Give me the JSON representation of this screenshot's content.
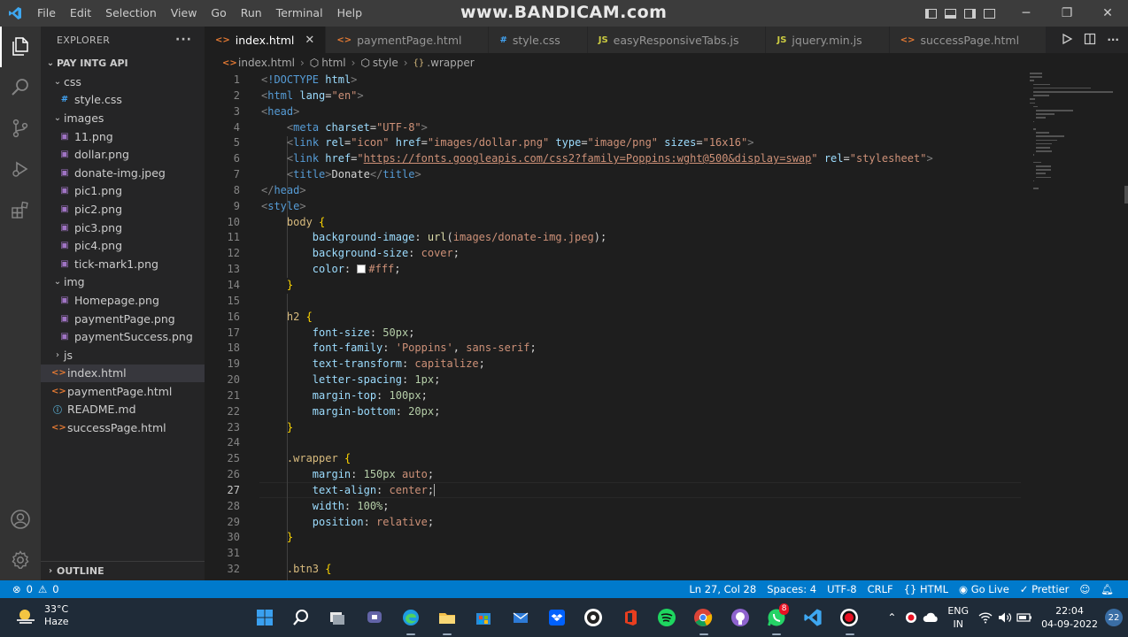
{
  "window": {
    "menu": [
      "File",
      "Edit",
      "Selection",
      "View",
      "Go",
      "Run",
      "Terminal",
      "Help"
    ],
    "watermark": "www.BANDICAM.com"
  },
  "sidebar": {
    "header": "EXPLORER",
    "more": "···",
    "project": "PAY INTG API",
    "tree": [
      {
        "label": "css",
        "type": "folder",
        "depth": 1,
        "open": true
      },
      {
        "label": "style.css",
        "type": "css",
        "depth": 2
      },
      {
        "label": "images",
        "type": "folder",
        "depth": 1,
        "open": true
      },
      {
        "label": "11.png",
        "type": "img",
        "depth": 2
      },
      {
        "label": "dollar.png",
        "type": "img",
        "depth": 2
      },
      {
        "label": "donate-img.jpeg",
        "type": "img",
        "depth": 2
      },
      {
        "label": "pic1.png",
        "type": "img",
        "depth": 2
      },
      {
        "label": "pic2.png",
        "type": "img",
        "depth": 2
      },
      {
        "label": "pic3.png",
        "type": "img",
        "depth": 2
      },
      {
        "label": "pic4.png",
        "type": "img",
        "depth": 2
      },
      {
        "label": "tick-mark1.png",
        "type": "img",
        "depth": 2
      },
      {
        "label": "img",
        "type": "folder",
        "depth": 1,
        "open": true
      },
      {
        "label": "Homepage.png",
        "type": "img",
        "depth": 2
      },
      {
        "label": "paymentPage.png",
        "type": "img",
        "depth": 2
      },
      {
        "label": "paymentSuccess.png",
        "type": "img",
        "depth": 2
      },
      {
        "label": "js",
        "type": "folder",
        "depth": 1,
        "open": false
      },
      {
        "label": "index.html",
        "type": "html",
        "depth": 1,
        "selected": true
      },
      {
        "label": "paymentPage.html",
        "type": "html",
        "depth": 1
      },
      {
        "label": "README.md",
        "type": "md",
        "depth": 1
      },
      {
        "label": "successPage.html",
        "type": "html",
        "depth": 1
      }
    ],
    "outline": "OUTLINE"
  },
  "tabs": [
    {
      "label": "index.html",
      "type": "html",
      "active": true,
      "close": "✕"
    },
    {
      "label": "paymentPage.html",
      "type": "html"
    },
    {
      "label": "style.css",
      "type": "css"
    },
    {
      "label": "easyResponsiveTabs.js",
      "type": "js"
    },
    {
      "label": "jquery.min.js",
      "type": "js"
    },
    {
      "label": "successPage.html",
      "type": "html"
    }
  ],
  "breadcrumb": [
    "index.html",
    "html",
    "style",
    ".wrapper"
  ],
  "editor": {
    "current_line": 27,
    "lines": [
      [
        [
          "t-br",
          "<"
        ],
        [
          "t-tag",
          "!DOCTYPE "
        ],
        [
          "t-attr",
          "html"
        ],
        [
          "t-br",
          ">"
        ]
      ],
      [
        [
          "t-br",
          "<"
        ],
        [
          "t-tag",
          "html "
        ],
        [
          "t-attr",
          "lang"
        ],
        [
          "t-plain",
          "="
        ],
        [
          "t-str",
          "\"en\""
        ],
        [
          "t-br",
          ">"
        ]
      ],
      [
        [
          "t-br",
          "<"
        ],
        [
          "t-tag",
          "head"
        ],
        [
          "t-br",
          ">"
        ]
      ],
      [
        [
          "t-plain",
          "    "
        ],
        [
          "t-br",
          "<"
        ],
        [
          "t-tag",
          "meta "
        ],
        [
          "t-attr",
          "charset"
        ],
        [
          "t-plain",
          "="
        ],
        [
          "t-str",
          "\"UTF-8\""
        ],
        [
          "t-br",
          ">"
        ]
      ],
      [
        [
          "t-plain",
          "    "
        ],
        [
          "t-br",
          "<"
        ],
        [
          "t-tag",
          "link "
        ],
        [
          "t-attr",
          "rel"
        ],
        [
          "t-plain",
          "="
        ],
        [
          "t-str",
          "\"icon\" "
        ],
        [
          "t-attr",
          "href"
        ],
        [
          "t-plain",
          "="
        ],
        [
          "t-str",
          "\"images/dollar.png\" "
        ],
        [
          "t-attr",
          "type"
        ],
        [
          "t-plain",
          "="
        ],
        [
          "t-str",
          "\"image/png\" "
        ],
        [
          "t-attr",
          "sizes"
        ],
        [
          "t-plain",
          "="
        ],
        [
          "t-str",
          "\"16x16\""
        ],
        [
          "t-br",
          ">"
        ]
      ],
      [
        [
          "t-plain",
          "    "
        ],
        [
          "t-br",
          "<"
        ],
        [
          "t-tag",
          "link "
        ],
        [
          "t-attr",
          "href"
        ],
        [
          "t-plain",
          "="
        ],
        [
          "t-str",
          "\""
        ],
        [
          "t-link",
          "https://fonts.googleapis.com/css2?family=Poppins:wght@500&display=swap"
        ],
        [
          "t-str",
          "\" "
        ],
        [
          "t-attr",
          "rel"
        ],
        [
          "t-plain",
          "="
        ],
        [
          "t-str",
          "\"stylesheet\""
        ],
        [
          "t-br",
          ">"
        ]
      ],
      [
        [
          "t-plain",
          "    "
        ],
        [
          "t-br",
          "<"
        ],
        [
          "t-tag",
          "title"
        ],
        [
          "t-br",
          ">"
        ],
        [
          "t-plain",
          "Donate"
        ],
        [
          "t-br",
          "</"
        ],
        [
          "t-tag",
          "title"
        ],
        [
          "t-br",
          ">"
        ]
      ],
      [
        [
          "t-br",
          "</"
        ],
        [
          "t-tag",
          "head"
        ],
        [
          "t-br",
          ">"
        ]
      ],
      [
        [
          "t-br",
          "<"
        ],
        [
          "t-tag",
          "style"
        ],
        [
          "t-br",
          ">"
        ]
      ],
      [
        [
          "t-plain",
          "    "
        ],
        [
          "t-sel",
          "body "
        ],
        [
          "t-brace",
          "{"
        ]
      ],
      [
        [
          "t-plain",
          "        "
        ],
        [
          "t-prop",
          "background-image"
        ],
        [
          "t-plain",
          ": "
        ],
        [
          "t-fn",
          "url"
        ],
        [
          "t-plain",
          "("
        ],
        [
          "t-val",
          "images/donate-img.jpeg"
        ],
        [
          "t-plain",
          ");"
        ]
      ],
      [
        [
          "t-plain",
          "        "
        ],
        [
          "t-prop",
          "background-size"
        ],
        [
          "t-plain",
          ": "
        ],
        [
          "t-val",
          "cover"
        ],
        [
          "t-plain",
          ";"
        ]
      ],
      [
        [
          "t-plain",
          "        "
        ],
        [
          "t-prop",
          "color"
        ],
        [
          "t-plain",
          ": "
        ],
        [
          "swatch",
          ""
        ],
        [
          "t-val",
          "#fff"
        ],
        [
          "t-plain",
          ";"
        ]
      ],
      [
        [
          "t-plain",
          "    "
        ],
        [
          "t-brace",
          "}"
        ]
      ],
      [],
      [
        [
          "t-plain",
          "    "
        ],
        [
          "t-sel",
          "h2 "
        ],
        [
          "t-brace",
          "{"
        ]
      ],
      [
        [
          "t-plain",
          "        "
        ],
        [
          "t-prop",
          "font-size"
        ],
        [
          "t-plain",
          ": "
        ],
        [
          "t-num",
          "50px"
        ],
        [
          "t-plain",
          ";"
        ]
      ],
      [
        [
          "t-plain",
          "        "
        ],
        [
          "t-prop",
          "font-family"
        ],
        [
          "t-plain",
          ": "
        ],
        [
          "t-val",
          "'Poppins'"
        ],
        [
          "t-plain",
          ", "
        ],
        [
          "t-val",
          "sans-serif"
        ],
        [
          "t-plain",
          ";"
        ]
      ],
      [
        [
          "t-plain",
          "        "
        ],
        [
          "t-prop",
          "text-transform"
        ],
        [
          "t-plain",
          ": "
        ],
        [
          "t-val",
          "capitalize"
        ],
        [
          "t-plain",
          ";"
        ]
      ],
      [
        [
          "t-plain",
          "        "
        ],
        [
          "t-prop",
          "letter-spacing"
        ],
        [
          "t-plain",
          ": "
        ],
        [
          "t-num",
          "1px"
        ],
        [
          "t-plain",
          ";"
        ]
      ],
      [
        [
          "t-plain",
          "        "
        ],
        [
          "t-prop",
          "margin-top"
        ],
        [
          "t-plain",
          ": "
        ],
        [
          "t-num",
          "100px"
        ],
        [
          "t-plain",
          ";"
        ]
      ],
      [
        [
          "t-plain",
          "        "
        ],
        [
          "t-prop",
          "margin-bottom"
        ],
        [
          "t-plain",
          ": "
        ],
        [
          "t-num",
          "20px"
        ],
        [
          "t-plain",
          ";"
        ]
      ],
      [
        [
          "t-plain",
          "    "
        ],
        [
          "t-brace",
          "}"
        ]
      ],
      [],
      [
        [
          "t-plain",
          "    "
        ],
        [
          "t-sel",
          ".wrapper "
        ],
        [
          "t-brace",
          "{"
        ]
      ],
      [
        [
          "t-plain",
          "        "
        ],
        [
          "t-prop",
          "margin"
        ],
        [
          "t-plain",
          ": "
        ],
        [
          "t-num",
          "150px"
        ],
        [
          "t-plain",
          " "
        ],
        [
          "t-val",
          "auto"
        ],
        [
          "t-plain",
          ";"
        ]
      ],
      [
        [
          "t-plain",
          "        "
        ],
        [
          "t-prop",
          "text-align"
        ],
        [
          "t-plain",
          ": "
        ],
        [
          "t-val",
          "center"
        ],
        [
          "t-plain",
          ";"
        ],
        [
          "caret",
          ""
        ]
      ],
      [
        [
          "t-plain",
          "        "
        ],
        [
          "t-prop",
          "width"
        ],
        [
          "t-plain",
          ": "
        ],
        [
          "t-num",
          "100%"
        ],
        [
          "t-plain",
          ";"
        ]
      ],
      [
        [
          "t-plain",
          "        "
        ],
        [
          "t-prop",
          "position"
        ],
        [
          "t-plain",
          ": "
        ],
        [
          "t-val",
          "relative"
        ],
        [
          "t-plain",
          ";"
        ]
      ],
      [
        [
          "t-plain",
          "    "
        ],
        [
          "t-brace",
          "}"
        ]
      ],
      [],
      [
        [
          "t-plain",
          "    "
        ],
        [
          "t-sel",
          ".btn3 "
        ],
        [
          "t-brace",
          "{"
        ]
      ]
    ]
  },
  "statusbar": {
    "errors": "0",
    "warnings": "0",
    "position": "Ln 27, Col 28",
    "spaces": "Spaces: 4",
    "encoding": "UTF-8",
    "eol": "CRLF",
    "language": "HTML",
    "golive": "Go Live",
    "prettier": "Prettier"
  },
  "taskbar": {
    "temp": "33°C",
    "condition": "Haze",
    "whatsapp_badge": "8",
    "lang_top": "ENG",
    "lang_bottom": "IN",
    "time": "22:04",
    "date": "04-09-2022",
    "notifications": "22"
  },
  "colors": {
    "accent": "#007acc",
    "titlebar": "#3c3c3c",
    "sidebar": "#252526",
    "editor": "#1e1e1e",
    "taskbar": "#1f2b38"
  }
}
